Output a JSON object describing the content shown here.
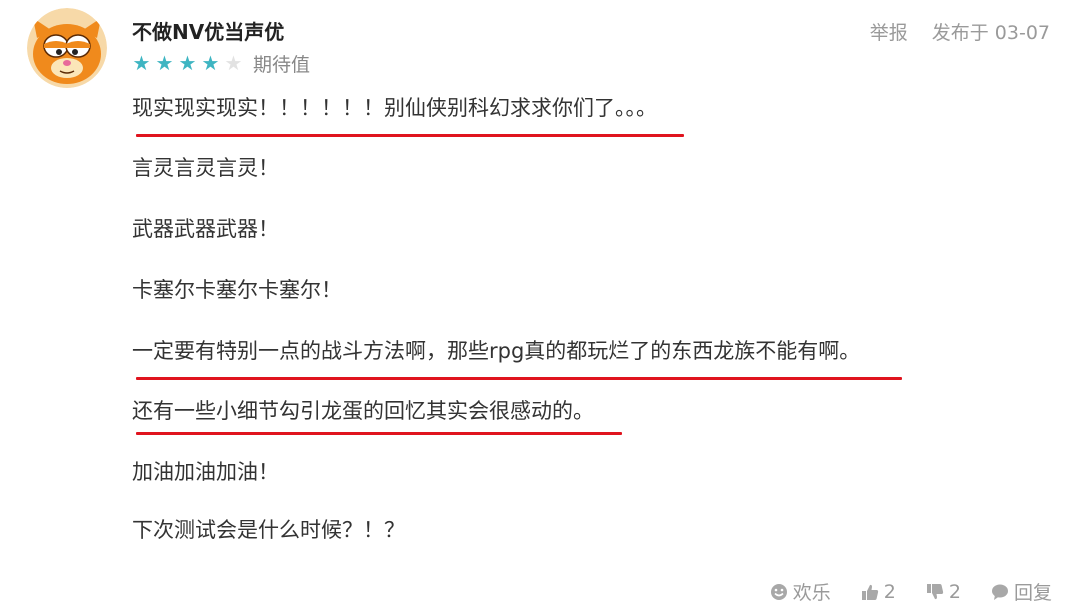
{
  "user": {
    "name": "不做NV优当声优",
    "rating_stars": 4,
    "rating_max": 5,
    "rating_label": "期待值",
    "avatar": "garfield-avatar-icon"
  },
  "header": {
    "report": "举报",
    "posted": "发布于 03-07"
  },
  "body": {
    "lines": [
      "现实现实现实！！！！！！别仙侠别科幻求求你们了。。。",
      "言灵言灵言灵！",
      "武器武器武器！",
      "卡塞尔卡塞尔卡塞尔！",
      "一定要有特别一点的战斗方法啊，那些rpg真的都玩烂了的东西龙族不能有啊。",
      "还有一些小细节勾引龙蛋的回忆其实会很感动的。",
      "加油加油加油！",
      "下次测试会是什么时候？！？"
    ],
    "underlined_lines": [
      0,
      4,
      5
    ],
    "underline_color": "#e0141e"
  },
  "footer": {
    "funny_label": "欢乐",
    "like_count": "2",
    "dislike_count": "2",
    "reply_label": "回复"
  },
  "colors": {
    "star_on": "#3eb5c2",
    "star_off": "#e2e2e2",
    "muted_text": "#9a9a9a"
  }
}
